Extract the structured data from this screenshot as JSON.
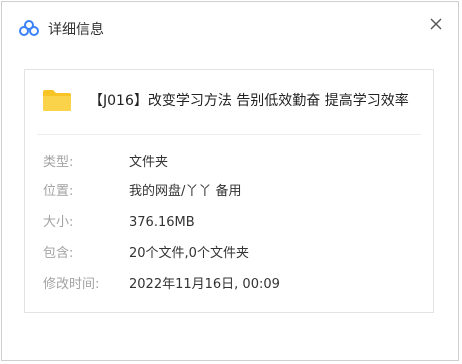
{
  "window": {
    "title": "详细信息",
    "icon": "cloud-logo-icon"
  },
  "file": {
    "icon": "folder-icon",
    "name": "【J016】改变学习方法 告别低效勤奋 提高学习效率"
  },
  "details": [
    {
      "label": "类型:",
      "value": "文件夹"
    },
    {
      "label": "位置:",
      "value": "我的网盘/丫丫 备用"
    },
    {
      "label": "大小:",
      "value": "376.16MB"
    },
    {
      "label": "包含:",
      "value": "20个文件,0个文件夹"
    },
    {
      "label": "修改时间:",
      "value": "2022年11月16日, 00:09"
    }
  ],
  "colors": {
    "accent": "#3b82f6",
    "folder": "#f8c325",
    "label": "#a3a3a3"
  }
}
